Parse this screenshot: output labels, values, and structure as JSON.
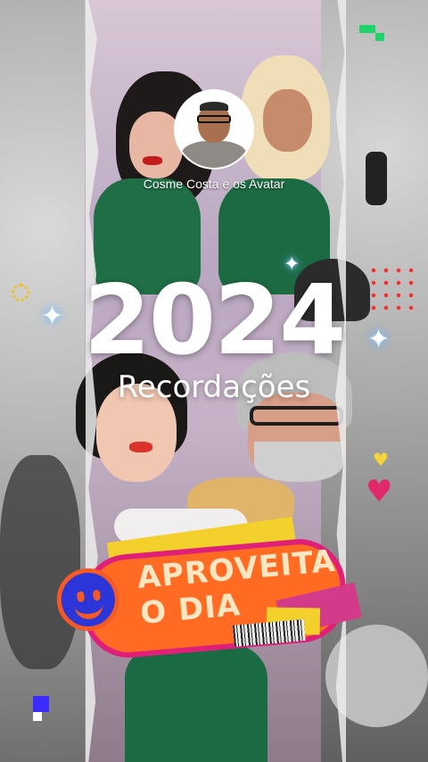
{
  "profile": {
    "name": "Cosme Costa e os Avatar"
  },
  "title": {
    "year": "2024",
    "subtitle": "Recordações"
  },
  "sticker": {
    "line1": "APROVEITA",
    "line2": "O DIA"
  },
  "icons": {
    "sparkles": [
      "sparkle-icon"
    ],
    "smiley": "smiley-icon",
    "heart": "heart-icon",
    "sun": "sun-icon"
  },
  "colors": {
    "sticker_orange": "#ff6b23",
    "sticker_pink": "#e01f78",
    "smiley_blue": "#2b35d8",
    "accent_green": "#1fd36b",
    "heart_pink": "#e0286b"
  }
}
